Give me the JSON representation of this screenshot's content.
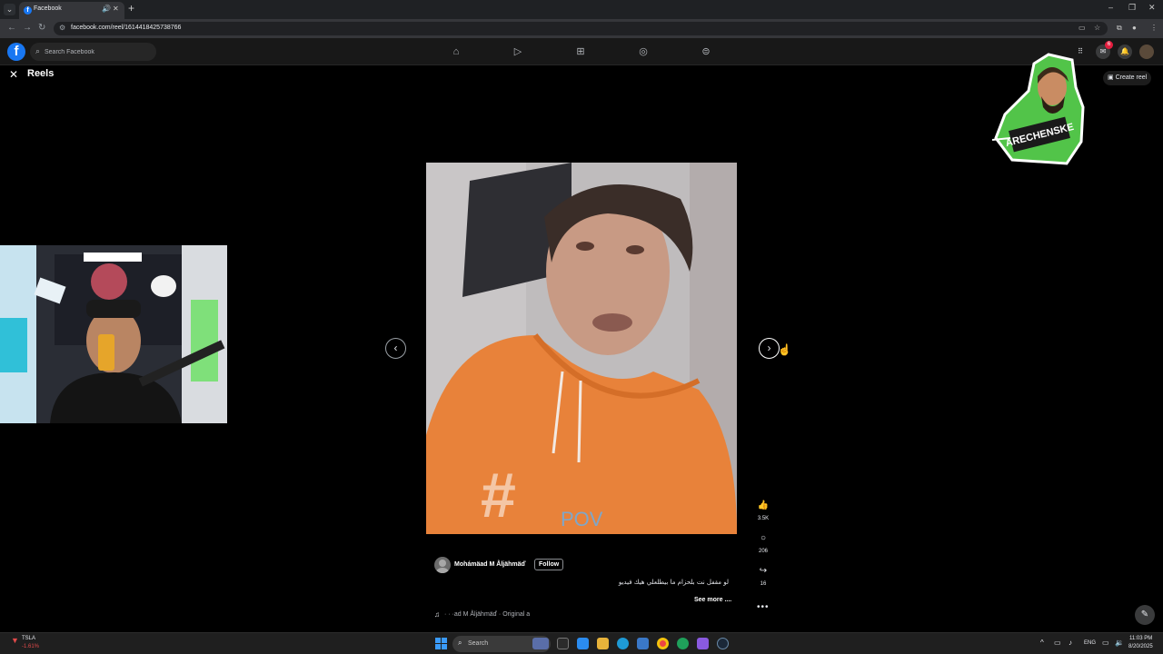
{
  "browser": {
    "tab_title": "Facebook",
    "tab_list_icon": "chevron-down-icon",
    "new_tab_icon": "plus-icon",
    "url": "facebook.com/reel/1614418425738766",
    "window_controls": [
      "minimize-icon",
      "restore-icon",
      "close-icon"
    ]
  },
  "fb": {
    "logo": "f",
    "search_placeholder": "Search Facebook",
    "nav": [
      "home-icon",
      "video-icon",
      "marketplace-icon",
      "groups-icon",
      "gaming-icon"
    ],
    "right_icons": [
      "menu-grid-icon",
      "messenger-icon",
      "notifications-icon",
      "account-avatar"
    ],
    "messenger_badge": "6"
  },
  "reels": {
    "title": "Reels",
    "create_reel_label": "Create reel",
    "author": "Mohámäad M Åljähmäď",
    "follow_label": "Follow",
    "caption": "لو مقفل نت بلحزام ما بيطلعلي هيك فيديو",
    "see_more_label": "See more ....",
    "audio_text": "· · ·ad M Åljähmäď · Original a",
    "video_overlay_text": "POV",
    "likes": "3.5K",
    "comments": "206",
    "shares": "16"
  },
  "sticker": {
    "text": "ARECHENSKE"
  },
  "taskbar": {
    "stock_name": "TSLA",
    "stock_change": "-1.61%",
    "search_label": "Search",
    "language": "ENG",
    "time": "11:03 PM",
    "date": "8/20/2025"
  },
  "colors": {
    "accent": "#1877f2",
    "background": "#000000",
    "header": "#181818",
    "hoodie": "#e8823a",
    "sticker_green": "#52c449"
  }
}
